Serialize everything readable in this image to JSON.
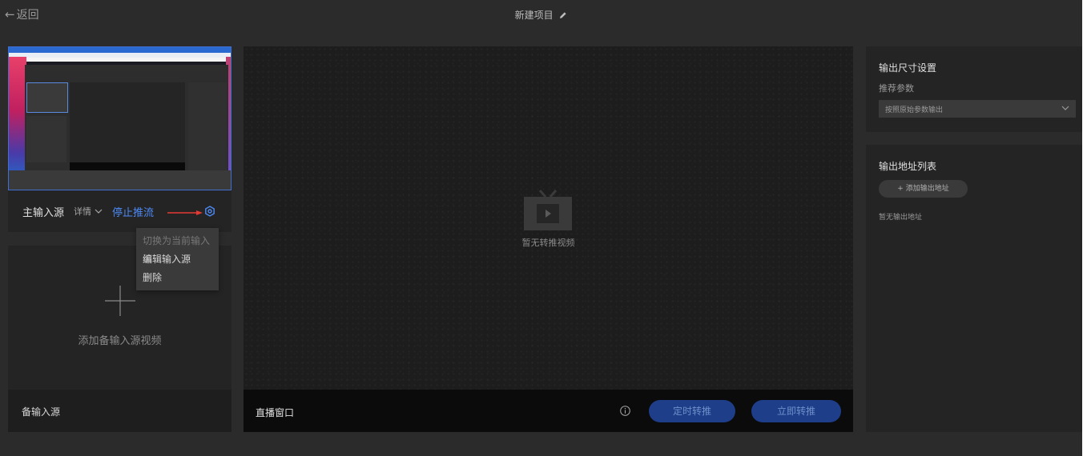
{
  "header": {
    "back_label": "返回",
    "project_title": "新建项目"
  },
  "main_source": {
    "label": "主输入源",
    "detail_label": "详情",
    "stop_label": "停止推流"
  },
  "context_menu": {
    "items": [
      {
        "label": "切换为当前输入源",
        "disabled": true
      },
      {
        "label": "编辑输入源",
        "disabled": false
      },
      {
        "label": "删除",
        "disabled": false
      }
    ]
  },
  "backup_source": {
    "add_label": "添加备输入源视频",
    "label": "备输入源"
  },
  "preview": {
    "empty_text": "暂无转推视频",
    "live_window_label": "直播窗口",
    "scheduled_button": "定时转推",
    "now_button": "立即转推"
  },
  "output_size": {
    "title": "输出尺寸设置",
    "subtitle": "推荐参数",
    "selected": "按照原始参数输出"
  },
  "output_addresses": {
    "title": "输出地址列表",
    "add_button": "+ 添加输出地址",
    "empty_text": "暂无输出地址"
  },
  "colors": {
    "accent": "#4d8af5",
    "button_bg": "#1e3e8a",
    "annotation_arrow": "#e53935"
  }
}
